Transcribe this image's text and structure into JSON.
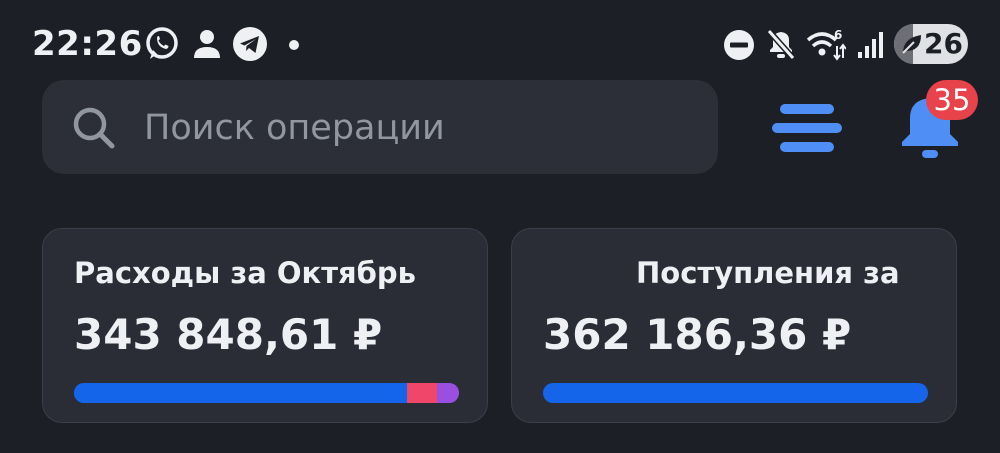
{
  "status_bar": {
    "time": "22:26",
    "battery_percent": "26",
    "battery_level": 0.26,
    "left_icons": [
      "whatsapp-icon",
      "person-icon",
      "telegram-icon",
      "dot-icon"
    ],
    "right_icons": [
      "do-not-disturb-icon",
      "muted-icon",
      "wifi-icon",
      "signal-icon"
    ]
  },
  "search": {
    "placeholder": "Поиск операции",
    "value": ""
  },
  "notifications": {
    "badge_count": "35"
  },
  "cards": {
    "expenses": {
      "title": "Расходы за Октябрь",
      "amount": "343 848,61 ₽",
      "segments": [
        {
          "share": 0.865,
          "color": "#1565ea"
        },
        {
          "share": 0.078,
          "color": "#f0466a"
        },
        {
          "share": 0.057,
          "color": "#9b4fe0"
        }
      ]
    },
    "income": {
      "title": "Поступления за",
      "amount": "362 186,36 ₽",
      "segments": [
        {
          "share": 1.0,
          "color": "#1565ea"
        }
      ]
    }
  },
  "colors": {
    "background": "#1d1f26",
    "accent": "#4f8ff5",
    "badge": "#e8424b"
  }
}
